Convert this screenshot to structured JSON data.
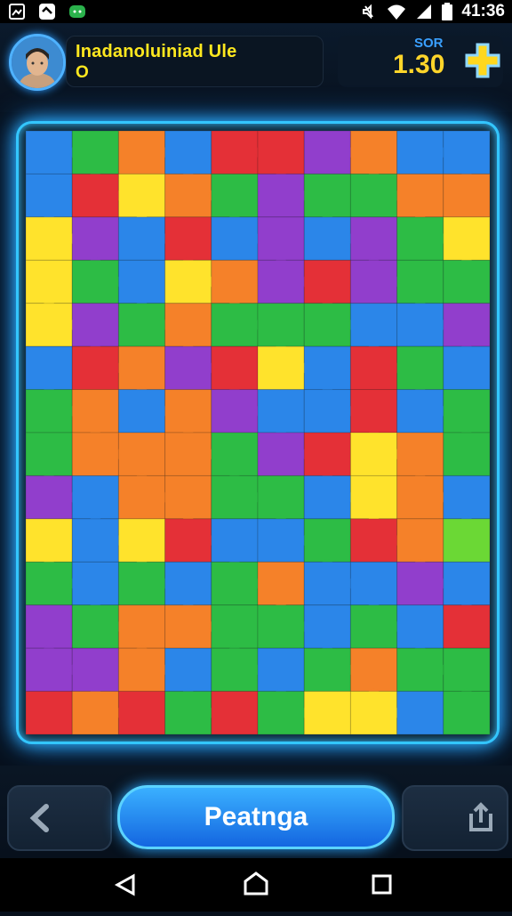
{
  "status_bar": {
    "time": "41:36",
    "icons": [
      "gallery-icon",
      "app-icon",
      "chat-icon",
      "mute-icon",
      "wifi-icon",
      "signal-icon",
      "battery-icon"
    ]
  },
  "header": {
    "title": "Inadanoluiniad Ule",
    "subtitle": "O",
    "score_label": "SOR",
    "score_value": "1.30"
  },
  "controls": {
    "main_button_label": "Peatnga",
    "back_icon": "chevron-left-icon",
    "share_icon": "share-icon"
  },
  "android_nav": {
    "icons": [
      "back-triangle-icon",
      "home-icon",
      "recents-icon"
    ]
  },
  "puzzle": {
    "cols": 10,
    "rows": 14,
    "palette": {
      "B": "#1e7fe8",
      "G": "#20b83a",
      "R": "#e3242b",
      "O": "#f57a1c",
      "Y": "#ffe21f",
      "P": "#8b32c9",
      "L": "#62d629"
    },
    "grid": [
      "BGOBRRPOBB",
      "BRYOGPGGOO",
      "YPBRBPBPGY",
      "YGBYOPRPGG",
      "YPGOGGGBBP",
      "BROPRYBRGB",
      "GOBOPBBRBG",
      "GOOOGPRYOG",
      "PBOOGGBYOB",
      "YBYRBBGROL",
      "GBGBGOBBPB",
      "PGOOGGBGBR",
      "PPOBGBGOGG",
      "RORGRGYYBG"
    ]
  }
}
